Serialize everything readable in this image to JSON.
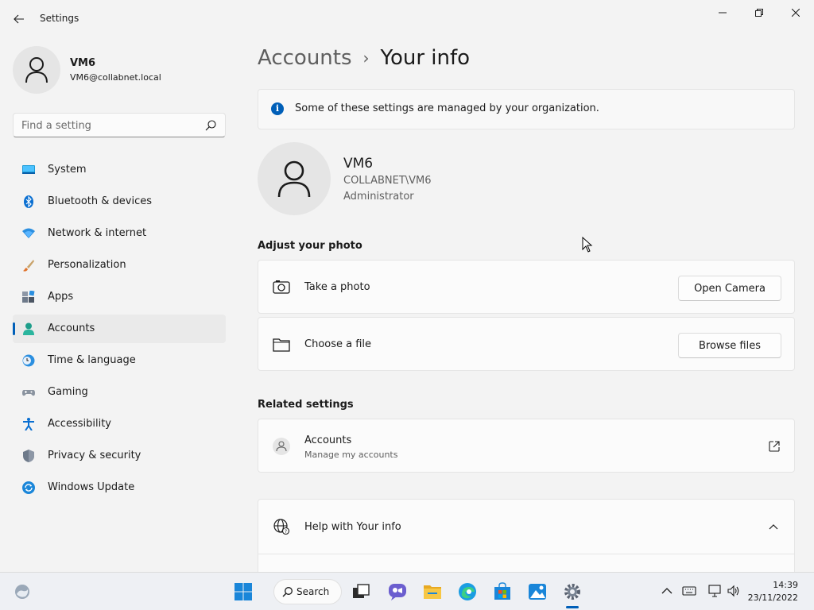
{
  "window": {
    "title": "Settings",
    "back_icon": "back-arrow-icon",
    "controls": [
      "minimize-icon",
      "restore-icon",
      "close-icon"
    ]
  },
  "profile": {
    "name": "VM6",
    "email": "VM6@collabnet.local"
  },
  "search": {
    "placeholder": "Find a setting"
  },
  "sidebar": {
    "items": [
      {
        "label": "System",
        "icon": "system-icon"
      },
      {
        "label": "Bluetooth & devices",
        "icon": "bluetooth-icon"
      },
      {
        "label": "Network & internet",
        "icon": "network-icon"
      },
      {
        "label": "Personalization",
        "icon": "brush-icon"
      },
      {
        "label": "Apps",
        "icon": "apps-icon"
      },
      {
        "label": "Accounts",
        "icon": "accounts-icon",
        "active": true
      },
      {
        "label": "Time & language",
        "icon": "clock-icon"
      },
      {
        "label": "Gaming",
        "icon": "gamepad-icon"
      },
      {
        "label": "Accessibility",
        "icon": "accessibility-icon"
      },
      {
        "label": "Privacy & security",
        "icon": "shield-icon"
      },
      {
        "label": "Windows Update",
        "icon": "update-icon"
      }
    ]
  },
  "main": {
    "breadcrumb": {
      "parent": "Accounts",
      "separator": "›",
      "current": "Your info"
    },
    "notice": "Some of these settings are managed by your organization.",
    "user": {
      "name": "VM6",
      "account": "COLLABNET\\VM6",
      "role": "Administrator"
    },
    "adjust_photo": {
      "title": "Adjust your photo",
      "take_photo": {
        "label": "Take a photo",
        "button": "Open Camera"
      },
      "choose_file": {
        "label": "Choose a file",
        "button": "Browse files"
      }
    },
    "related": {
      "title": "Related settings",
      "accounts": {
        "label": "Accounts",
        "sub": "Manage my accounts"
      }
    },
    "help": {
      "label": "Help with Your info"
    }
  },
  "taskbar": {
    "search_label": "Search",
    "time": "14:39",
    "date": "23/11/2022"
  },
  "colors": {
    "accent": "#005fb8",
    "background": "#f3f3f3",
    "card": "#fbfbfb"
  }
}
